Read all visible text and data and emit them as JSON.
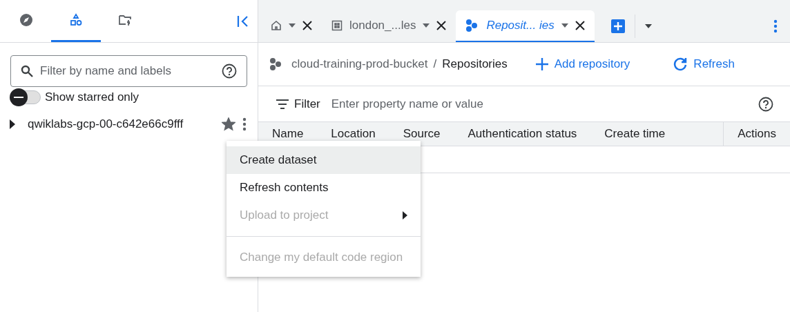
{
  "sidebar": {
    "tabs": [
      {
        "selected": false
      },
      {
        "selected": true
      },
      {
        "selected": false
      }
    ],
    "search": {
      "placeholder": "Filter by name and labels"
    },
    "starred_toggle": {
      "label": "Show starred only",
      "on": false
    },
    "tree": [
      {
        "label": "qwiklabs-gcp-00-c642e66c9fff",
        "expanded": false,
        "starred": true
      }
    ]
  },
  "context_menu": [
    {
      "kind": "item",
      "label": "Create dataset",
      "disabled": false,
      "selected": true,
      "submenu": false
    },
    {
      "kind": "item",
      "label": "Refresh contents",
      "disabled": false,
      "selected": false,
      "submenu": false
    },
    {
      "kind": "item",
      "label": "Upload to project",
      "disabled": true,
      "selected": false,
      "submenu": true
    },
    {
      "kind": "divider"
    },
    {
      "kind": "item",
      "label": "Change my default code region",
      "disabled": true,
      "selected": false,
      "submenu": false
    }
  ],
  "tabs": [
    {
      "selected": false
    },
    {
      "label": "london_...les",
      "selected": false
    },
    {
      "label": "Reposit... ies",
      "selected": true
    }
  ],
  "breadcrumb": {
    "parent": "cloud-training-prod-bucket",
    "separator": "/",
    "current": "Repositories"
  },
  "actions": [
    {
      "label": "Add repository"
    },
    {
      "label": "Refresh"
    }
  ],
  "filter": {
    "label": "Filter",
    "placeholder": "Enter property name or value"
  },
  "table": {
    "columns": [
      "Name",
      "Location",
      "Source",
      "Authentication status",
      "Create time"
    ],
    "actions_column": "Actions"
  }
}
